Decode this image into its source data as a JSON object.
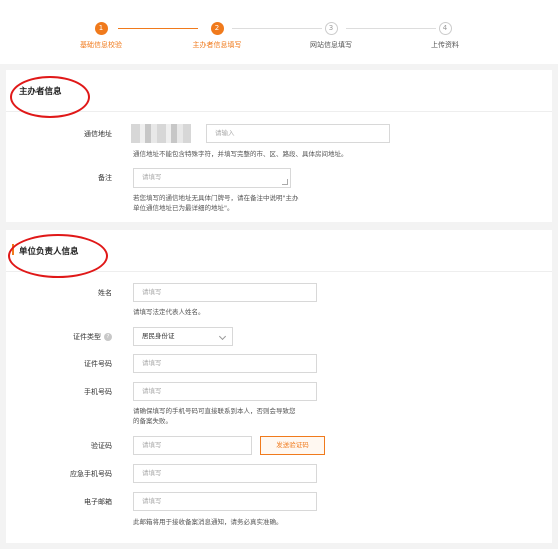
{
  "steps": [
    {
      "num": "1",
      "label": "基础信息校验",
      "state": "active"
    },
    {
      "num": "2",
      "label": "主办者信息填写",
      "state": "active"
    },
    {
      "num": "3",
      "label": "网站信息填写",
      "state": "inactive"
    },
    {
      "num": "4",
      "label": "上传资料",
      "state": "inactive"
    }
  ],
  "sponsor": {
    "title": "主办者信息",
    "address_label": "通信地址",
    "address_placeholder": "请输入",
    "address_hint": "通信地址不能包含特殊字符，并填写完整的市、区、路段、具体房间地址。",
    "remark_label": "备注",
    "remark_placeholder": "请填写",
    "remark_hint_1": "若您填写的通信地址无具体门牌号，请在备注中说明\"主办",
    "remark_hint_2": "单位通信地址已为最详细的地址\"。"
  },
  "principal": {
    "title": "单位负责人信息",
    "name_label": "姓名",
    "name_placeholder": "请填写",
    "name_hint": "请填写法定代表人姓名。",
    "id_type_label": "证件类型",
    "id_type_value": "居民身份证",
    "id_no_label": "证件号码",
    "id_no_placeholder": "请填写",
    "phone_label": "手机号码",
    "phone_placeholder": "请填写",
    "phone_hint_1": "请确保填写的手机号码可直接联系到本人，否则会导致您",
    "phone_hint_2": "的备案失败。",
    "code_label": "验证码",
    "code_placeholder": "请填写",
    "send_code": "发送验证码",
    "emergency_label": "应急手机号码",
    "emergency_placeholder": "请填写",
    "email_label": "电子邮箱",
    "email_placeholder": "请填写",
    "email_hint": "此邮箱将用于接收备案消息通知，请务必真实准确。"
  },
  "colors": {
    "accent": "#f07a1c",
    "annotation": "#e01818"
  }
}
